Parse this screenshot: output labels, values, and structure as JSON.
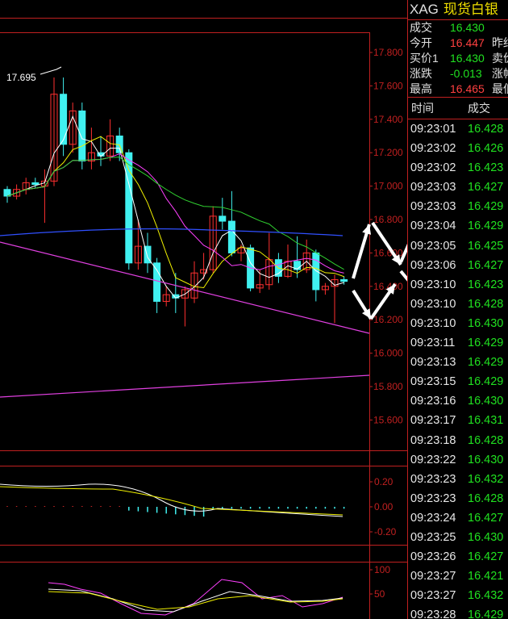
{
  "header": {
    "symbol": "XAG",
    "name": "现货白银"
  },
  "quote": [
    {
      "label": "成交",
      "value": "16.430",
      "color": "green",
      "label2": ""
    },
    {
      "label": "今开",
      "value": "16.447",
      "color": "red",
      "label2": "昨结"
    },
    {
      "label": "买价1",
      "value": "16.430",
      "color": "green",
      "label2": "卖价"
    },
    {
      "label": "涨跌",
      "value": "-0.013",
      "color": "green",
      "label2": "涨幅"
    },
    {
      "label": "最高",
      "value": "16.465",
      "color": "red",
      "label2": "最低"
    }
  ],
  "ticks_header": {
    "time": "时间",
    "price": "成交"
  },
  "ticks": [
    {
      "time": "09:23:01",
      "price": "16.428"
    },
    {
      "time": "09:23:02",
      "price": "16.426"
    },
    {
      "time": "09:23:02",
      "price": "16.423"
    },
    {
      "time": "09:23:03",
      "price": "16.427"
    },
    {
      "time": "09:23:03",
      "price": "16.429"
    },
    {
      "time": "09:23:04",
      "price": "16.429"
    },
    {
      "time": "09:23:05",
      "price": "16.425"
    },
    {
      "time": "09:23:06",
      "price": "16.427"
    },
    {
      "time": "09:23:10",
      "price": "16.423"
    },
    {
      "time": "09:23:10",
      "price": "16.428"
    },
    {
      "time": "09:23:10",
      "price": "16.430"
    },
    {
      "time": "09:23:11",
      "price": "16.429"
    },
    {
      "time": "09:23:13",
      "price": "16.429"
    },
    {
      "time": "09:23:15",
      "price": "16.429"
    },
    {
      "time": "09:23:16",
      "price": "16.430"
    },
    {
      "time": "09:23:17",
      "price": "16.431"
    },
    {
      "time": "09:23:18",
      "price": "16.428"
    },
    {
      "time": "09:23:22",
      "price": "16.430"
    },
    {
      "time": "09:23:23",
      "price": "16.432"
    },
    {
      "time": "09:23:23",
      "price": "16.428"
    },
    {
      "time": "09:23:24",
      "price": "16.427"
    },
    {
      "time": "09:23:25",
      "price": "16.430"
    },
    {
      "time": "09:23:26",
      "price": "16.427"
    },
    {
      "time": "09:23:27",
      "price": "16.421"
    },
    {
      "time": "09:23:27",
      "price": "16.432"
    },
    {
      "time": "09:23:28",
      "price": "16.429"
    }
  ],
  "chart_data": {
    "type": "candlestick",
    "price_axis": {
      "ticks": [
        "17.800",
        "17.600",
        "17.400",
        "17.200",
        "17.000",
        "16.800",
        "16.600",
        "16.400",
        "16.200",
        "16.000",
        "15.800",
        "15.600"
      ]
    },
    "max_label": "17.695",
    "macd_axis": {
      "ticks": [
        "0.20",
        "0.00",
        "-0.20"
      ]
    },
    "kdj_axis": {
      "ticks": [
        "100",
        "50"
      ]
    },
    "candles": [
      {
        "o": 16.98,
        "c": 16.94,
        "h": 17.0,
        "l": 16.9
      },
      {
        "o": 16.94,
        "c": 16.98,
        "h": 17.01,
        "l": 16.92
      },
      {
        "o": 16.98,
        "c": 17.02,
        "h": 17.05,
        "l": 16.95
      },
      {
        "o": 17.02,
        "c": 17.01,
        "h": 17.05,
        "l": 16.99
      },
      {
        "o": 17.0,
        "c": 17.03,
        "h": 17.1,
        "l": 16.78
      },
      {
        "o": 17.03,
        "c": 17.55,
        "h": 17.65,
        "l": 17.0
      },
      {
        "o": 17.55,
        "c": 17.25,
        "h": 17.65,
        "l": 17.18
      },
      {
        "o": 17.25,
        "c": 17.45,
        "h": 17.5,
        "l": 17.2
      },
      {
        "o": 17.45,
        "c": 17.15,
        "h": 17.5,
        "l": 17.1
      },
      {
        "o": 17.15,
        "c": 17.2,
        "h": 17.35,
        "l": 17.1
      },
      {
        "o": 17.2,
        "c": 17.18,
        "h": 17.3,
        "l": 17.12
      },
      {
        "o": 17.18,
        "c": 17.3,
        "h": 17.4,
        "l": 17.15
      },
      {
        "o": 17.3,
        "c": 17.2,
        "h": 17.35,
        "l": 17.15
      },
      {
        "o": 17.2,
        "c": 16.54,
        "h": 17.22,
        "l": 16.5
      },
      {
        "o": 16.54,
        "c": 16.64,
        "h": 16.8,
        "l": 16.5
      },
      {
        "o": 16.64,
        "c": 16.54,
        "h": 16.72,
        "l": 16.48
      },
      {
        "o": 16.54,
        "c": 16.31,
        "h": 16.57,
        "l": 16.24
      },
      {
        "o": 16.31,
        "c": 16.35,
        "h": 16.4,
        "l": 16.28
      },
      {
        "o": 16.35,
        "c": 16.33,
        "h": 16.48,
        "l": 16.24
      },
      {
        "o": 16.33,
        "c": 16.38,
        "h": 16.4,
        "l": 16.16
      },
      {
        "o": 16.33,
        "c": 16.48,
        "h": 16.55,
        "l": 16.3
      },
      {
        "o": 16.48,
        "c": 16.5,
        "h": 16.6,
        "l": 16.44
      },
      {
        "o": 16.5,
        "c": 16.82,
        "h": 16.88,
        "l": 16.48
      },
      {
        "o": 16.82,
        "c": 16.79,
        "h": 16.93,
        "l": 16.74
      },
      {
        "o": 16.79,
        "c": 16.6,
        "h": 16.97,
        "l": 16.58
      },
      {
        "o": 16.6,
        "c": 16.63,
        "h": 16.65,
        "l": 16.55
      },
      {
        "o": 16.63,
        "c": 16.39,
        "h": 16.65,
        "l": 16.37
      },
      {
        "o": 16.39,
        "c": 16.41,
        "h": 16.5,
        "l": 16.36
      },
      {
        "o": 16.41,
        "c": 16.56,
        "h": 16.72,
        "l": 16.38
      },
      {
        "o": 16.56,
        "c": 16.46,
        "h": 16.6,
        "l": 16.42
      },
      {
        "o": 16.46,
        "c": 16.55,
        "h": 16.65,
        "l": 16.45
      },
      {
        "o": 16.55,
        "c": 16.5,
        "h": 16.7,
        "l": 16.45
      },
      {
        "o": 16.5,
        "c": 16.6,
        "h": 16.68,
        "l": 16.48
      },
      {
        "o": 16.6,
        "c": 16.38,
        "h": 16.62,
        "l": 16.31
      },
      {
        "o": 16.38,
        "c": 16.4,
        "h": 16.42,
        "l": 16.35
      },
      {
        "o": 16.4,
        "c": 16.44,
        "h": 16.47,
        "l": 16.18
      },
      {
        "o": 16.44,
        "c": 16.43,
        "h": 16.46,
        "l": 16.41
      }
    ]
  }
}
